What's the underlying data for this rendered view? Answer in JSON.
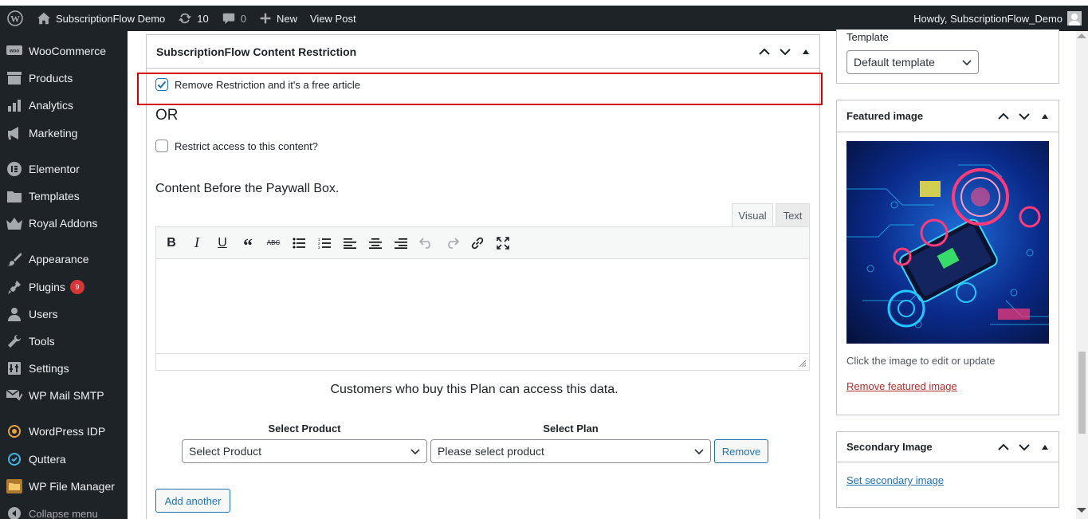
{
  "admin_bar": {
    "site_name": "SubscriptionFlow Demo",
    "updates_count": "10",
    "comments_count": "0",
    "new_label": "New",
    "view_post_label": "View Post",
    "howdy": "Howdy, SubscriptionFlow_Demo"
  },
  "sidebar": {
    "items": [
      {
        "label": "WooCommerce",
        "icon": "woo-icon"
      },
      {
        "label": "Products",
        "icon": "archive-icon"
      },
      {
        "label": "Analytics",
        "icon": "chart-bar-icon"
      },
      {
        "label": "Marketing",
        "icon": "megaphone-icon"
      },
      {
        "label": "Elementor",
        "icon": "elementor-icon"
      },
      {
        "label": "Templates",
        "icon": "folder-icon"
      },
      {
        "label": "Royal Addons",
        "icon": "crown-icon"
      },
      {
        "label": "Appearance",
        "icon": "paintbrush-icon"
      },
      {
        "label": "Plugins",
        "icon": "plugin-icon",
        "badge": "9"
      },
      {
        "label": "Users",
        "icon": "user-icon"
      },
      {
        "label": "Tools",
        "icon": "wrench-icon"
      },
      {
        "label": "Settings",
        "icon": "settings-icon"
      },
      {
        "label": "WP Mail SMTP",
        "icon": "mail-icon"
      },
      {
        "label": "WordPress IDP",
        "icon": "idp-icon"
      },
      {
        "label": "Quttera",
        "icon": "quttera-icon"
      },
      {
        "label": "WP File Manager",
        "icon": "file-manager-icon"
      }
    ],
    "collapse_label": "Collapse menu"
  },
  "restriction_box": {
    "title": "SubscriptionFlow Content Restriction",
    "remove_restriction_label": "Remove Restriction and it's a free article",
    "remove_restriction_checked": true,
    "or_label": "OR",
    "restrict_access_label": "Restrict access to this content?",
    "restrict_access_checked": false,
    "content_before_label": "Content Before the Paywall Box.",
    "editor_tabs": {
      "visual": "Visual",
      "text": "Text"
    },
    "toolbar_tools": [
      "bold-icon",
      "italic-icon",
      "underline-icon",
      "blockquote-icon",
      "strikethrough-icon",
      "bullet-list-icon",
      "numbered-list-icon",
      "align-left-icon",
      "align-center-icon",
      "align-right-icon",
      "undo-icon",
      "redo-icon",
      "link-icon",
      "fullscreen-icon"
    ],
    "plan_access_text": "Customers who buy this Plan can access this data.",
    "select_product_label": "Select Product",
    "select_plan_label": "Select Plan",
    "product_select_value": "Select Product",
    "plan_select_value": "Please select product",
    "remove_button": "Remove",
    "add_another_button": "Add another"
  },
  "template_box": {
    "label": "Template",
    "value": "Default template"
  },
  "featured_image_box": {
    "title": "Featured image",
    "hint": "Click the image to edit or update",
    "remove_link": "Remove featured image"
  },
  "secondary_image_box": {
    "title": "Secondary Image",
    "set_link": "Set secondary image"
  },
  "colors": {
    "admin_dark": "#1d2327",
    "link_blue": "#2271b1",
    "highlight_red": "#d40000",
    "badge_red": "#d63638"
  }
}
